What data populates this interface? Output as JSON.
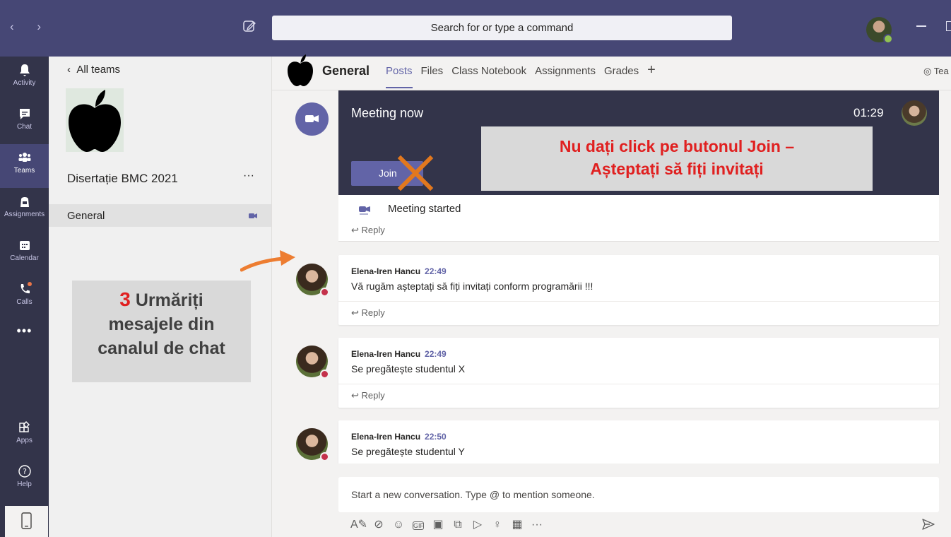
{
  "topbar": {
    "nav_arrows": "‹ ›",
    "search_placeholder": "Search for or type a command"
  },
  "rail": {
    "items": [
      {
        "label": "Activity"
      },
      {
        "label": "Chat"
      },
      {
        "label": "Teams"
      },
      {
        "label": "Assignments"
      },
      {
        "label": "Calendar"
      },
      {
        "label": "Calls"
      }
    ],
    "more": "•••",
    "apps": "Apps",
    "help": "Help"
  },
  "team": {
    "back_label": "All teams",
    "name": "Disertație BMC 2021",
    "more": "···",
    "channel": "General"
  },
  "instruction3": {
    "number": "3",
    "line1": "Urmăriți",
    "line2": "mesajele din",
    "line3": "canalul de chat"
  },
  "channel_header": {
    "title": "General",
    "tabs": [
      "Posts",
      "Files",
      "Class Notebook",
      "Assignments",
      "Grades"
    ],
    "plus": "+",
    "team_button": "◎ Tea"
  },
  "meeting": {
    "title": "Meeting now",
    "duration": "01:29",
    "join_label": "Join",
    "warning_line1": "Nu dați click pe butonul Join –",
    "warning_line2": "Așteptați să fiți invitați",
    "started": "Meeting started",
    "reply": "Reply"
  },
  "messages": [
    {
      "author": "Elena-Iren Hancu",
      "time": "22:49",
      "text": "Vă rugăm așteptați să fiți invitați conform programării !!!",
      "reply": "Reply"
    },
    {
      "author": "Elena-Iren Hancu",
      "time": "22:49",
      "text": "Se pregătește studentul X",
      "reply": "Reply"
    },
    {
      "author": "Elena-Iren Hancu",
      "time": "22:50",
      "text": "Se pregătește studentul Y",
      "reply": ""
    }
  ],
  "compose": {
    "placeholder": "Start a new conversation. Type @ to mention someone.",
    "tools": [
      "A✎",
      "⊘",
      "☺",
      "GIF",
      "▣",
      "⧉",
      "▷",
      "♀",
      "▦",
      "···"
    ]
  },
  "colors": {
    "brand": "#6264a7",
    "topbar": "#464775",
    "rail": "#33344a",
    "warning": "#e02020"
  }
}
